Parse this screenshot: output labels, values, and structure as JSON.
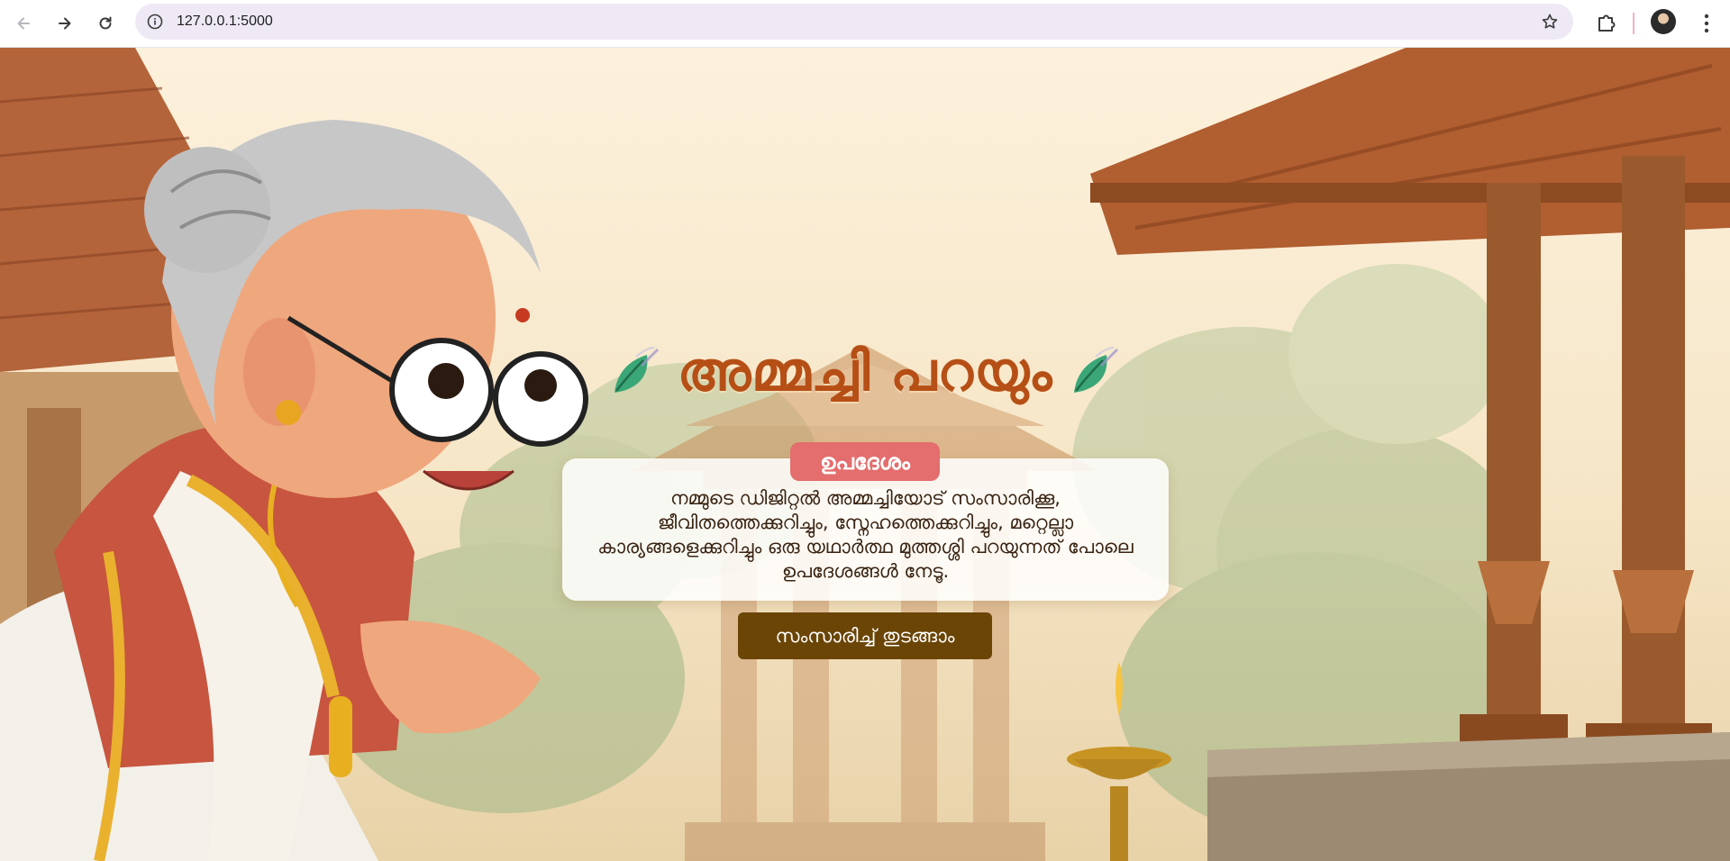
{
  "browser": {
    "url": "127.0.0.1:5000"
  },
  "hero": {
    "title": "അമ്മച്ചി പറയും",
    "badge": "ഉപദേശം",
    "description": "നമ്മുടെ ഡിജിറ്റൽ അമ്മച്ചിയോട് സംസാരിക്കൂ, ജീവിതത്തെക്കുറിച്ചും, സ്നേഹത്തെക്കുറിച്ചും, മറ്റെല്ലാ കാര്യങ്ങളെക്കുറിച്ചും ഒരു യഥാർത്ഥ മുത്തശ്ശി പറയുന്നത് പോലെ ഉപദേശങ്ങൾ നേടൂ.",
    "start_button": "സംസാരിച്ച് തുടങ്ങാം"
  },
  "colors": {
    "title": "#b64f16",
    "badge": "#e46d6d",
    "button": "#6a4506",
    "leaf": "#3ba677"
  }
}
